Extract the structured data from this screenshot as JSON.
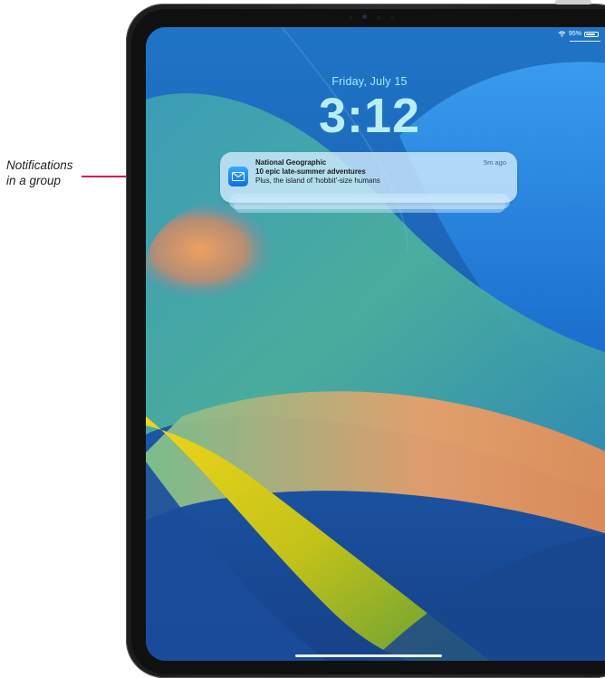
{
  "callout": {
    "line1": "Notifications",
    "line2": "in a group",
    "color": "#d5154f"
  },
  "status_bar": {
    "battery_text": "95%",
    "wifi_icon": "wifi-icon",
    "battery_icon": "battery-icon"
  },
  "lock_screen": {
    "date": "Friday, July 15",
    "time": "3:12"
  },
  "notification": {
    "app_name": "National Geographic",
    "time_ago": "5m ago",
    "title": "10 epic late-summer adventures",
    "body": "Plus, the island of 'hobbit'-size humans",
    "icon": "mail-icon",
    "group_count_visible": 3
  },
  "colors": {
    "wallpaper_blue": "#1b5fb6",
    "wallpaper_teal": "#2fa6a8",
    "wallpaper_orange": "#e8955a",
    "wallpaper_yellow": "#d7c21a",
    "clock_color": "#b8ecff"
  }
}
